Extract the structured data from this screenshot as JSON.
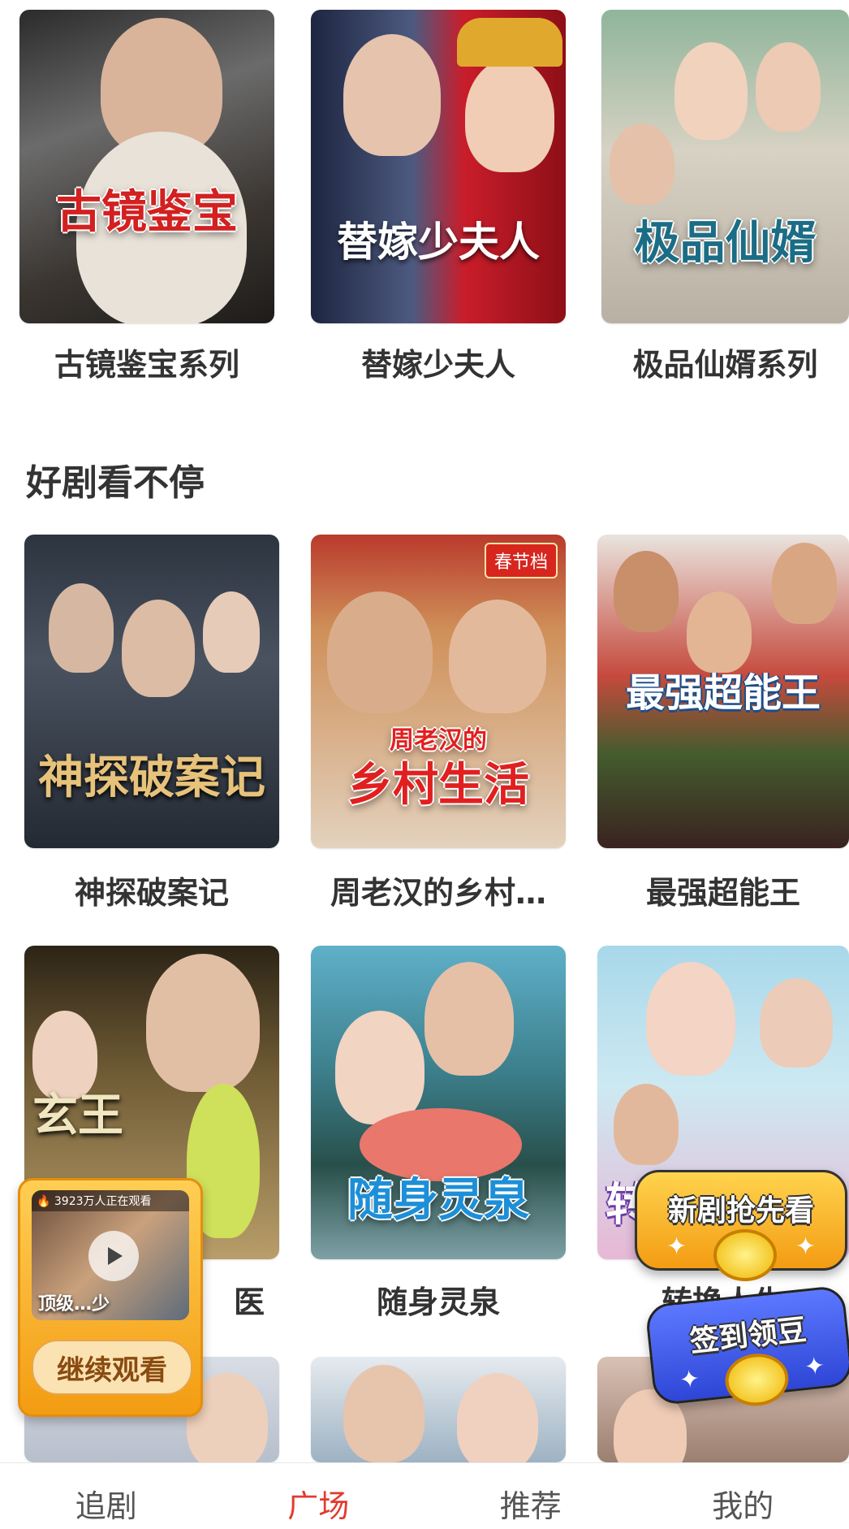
{
  "row1": [
    {
      "title": "古镜鉴宝系列",
      "poster_text": "古镜鉴宝",
      "poster_color": "#d32020"
    },
    {
      "title": "替嫁少夫人",
      "poster_text": "替嫁少夫人",
      "poster_color": "#ffffff"
    },
    {
      "title": "极品仙婿系列",
      "poster_text": "极品仙婿",
      "poster_color": "#1b6d86"
    }
  ],
  "section": {
    "title": "好剧看不停"
  },
  "row2": [
    {
      "title": "神探破案记",
      "poster_text": "神探破案记",
      "poster_color": "#e7c27a"
    },
    {
      "title": "周老汉的乡村…",
      "poster_small": "周老汉的",
      "poster_text": "乡村生活",
      "badge": "春节档",
      "poster_color": "#e21f1f"
    },
    {
      "title": "最强超能王",
      "poster_text": "最强超能王",
      "poster_color": "#ffffff"
    }
  ],
  "row3": [
    {
      "title": "医",
      "poster_text": "玄王",
      "poster_color": "#f0e6c0"
    },
    {
      "title": "随身灵泉",
      "poster_text": "随身灵泉",
      "poster_color": "#1d8fd8"
    },
    {
      "title": "转换人生",
      "poster_text": "转",
      "poster_color": "#ffffff"
    }
  ],
  "mini_player": {
    "viewers": "3923万人正在观看",
    "thumb_text": "顶级…少",
    "continue_label": "继续观看"
  },
  "promos": {
    "new_drama": "新剧抢先看",
    "sign_in": "签到领豆"
  },
  "nav": {
    "items": [
      "追剧",
      "广场",
      "推荐",
      "我的"
    ],
    "active": "广场"
  },
  "icons": {
    "play": "play-icon",
    "fire": "fire-icon",
    "sparkle": "sparkle-icon",
    "coin": "coin-icon"
  }
}
